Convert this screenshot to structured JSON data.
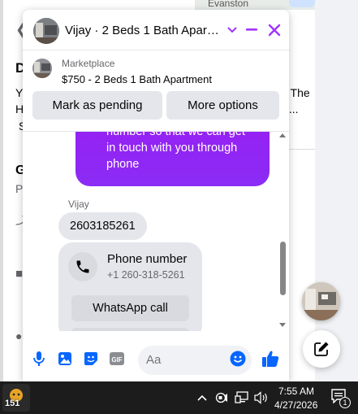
{
  "background_page": {
    "map_label": "Evanston",
    "fragments": [
      {
        "name": "bg-heading-d",
        "text": "D"
      },
      {
        "name": "bg-text-y",
        "text": "Y"
      },
      {
        "name": "bg-text-h",
        "text": "H"
      },
      {
        "name": "bg-text-s",
        "text": "S"
      },
      {
        "name": "bg-text-the",
        "text": "t The"
      },
      {
        "name": "bg-text-ellipsis",
        "text": "y ..."
      },
      {
        "name": "bg-heading-g",
        "text": "G"
      },
      {
        "name": "bg-text-p",
        "text": "P"
      }
    ]
  },
  "chat": {
    "title": "Vijay · 2 Beds 1 Bath Apart…",
    "listing": {
      "source": "Marketplace",
      "title": "$750 - 2 Beds 1 Bath Apartment",
      "mark_pending_label": "Mark as pending",
      "more_options_label": "More options"
    },
    "messages": {
      "outgoing_lines": [
        "number so that we can get",
        "in touch with you through",
        "phone"
      ],
      "sender_name": "Vijay",
      "incoming_text": "2603185261",
      "phone_card": {
        "label": "Phone number",
        "number": "+1 260-318-5261",
        "whatsapp_label": "WhatsApp call"
      }
    },
    "composer": {
      "placeholder": "Aa",
      "icons": [
        "microphone-icon",
        "image-icon",
        "sticker-icon",
        "gif-icon",
        "emoji-icon",
        "thumbs-up-icon"
      ],
      "gif_text": "GIF"
    },
    "accent_color": "#a033ff"
  },
  "taskbar": {
    "app_badge": "151",
    "time": "7:55 AM",
    "date": "4/27/2026",
    "notification_count": "1"
  }
}
